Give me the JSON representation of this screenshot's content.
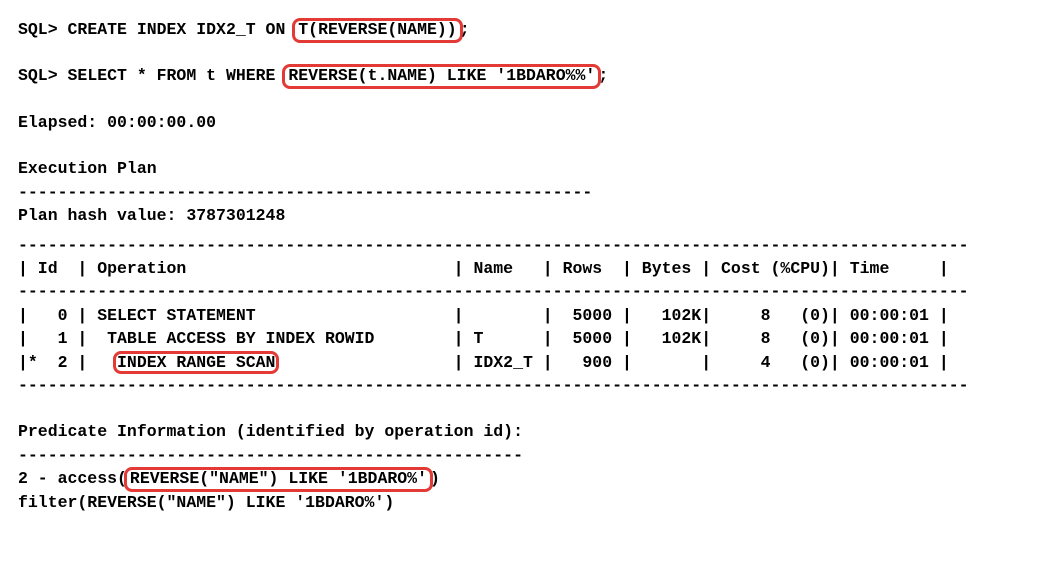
{
  "prompt": "SQL> ",
  "stmt_create": {
    "before_hl": "CREATE INDEX IDX2_T ON ",
    "hl": "T(REVERSE(NAME))",
    "after_hl": ";"
  },
  "stmt_select": {
    "before_hl": "SELECT * FROM t WHERE ",
    "hl": "REVERSE(t.NAME) LIKE '1BDARO%%'",
    "after_hl": ";"
  },
  "elapsed": "Elapsed: 00:00:00.00",
  "ep_title": "Execution Plan",
  "ep_rule": "----------------------------------------------------------",
  "plan_hash": "Plan hash value: 3787301248",
  "table": {
    "rule": "------------------------------------------------------------------------------------------------",
    "head": "| Id  | Operation                           | Name   | Rows  | Bytes | Cost (%CPU)| Time     |",
    "r0": "|   0 | SELECT STATEMENT                    |        |  5000 |   102K|     8   (0)| 00:00:01 |",
    "r1": "|   1 |  TABLE ACCESS BY INDEX ROWID        | T      |  5000 |   102K|     8   (0)| 00:00:01 |",
    "r2": "|*  2 |   INDEX RANGE SCAN                  | IDX2_T |   900 |       |     4   (0)| 00:00:01 |"
  },
  "pred_title": "Predicate Information (identified by operation id):",
  "pred_rule": "---------------------------------------------------",
  "pred": {
    "access_before": "   2 - access(",
    "access_hl": "REVERSE(\"NAME\") LIKE '1BDARO%'",
    "access_after": ")",
    "filter": "       filter(REVERSE(\"NAME\") LIKE '1BDARO%')"
  },
  "chart_data": {
    "type": "table",
    "title": "Execution Plan",
    "plan_hash_value": 3787301248,
    "columns": [
      "Id",
      "Operation",
      "Name",
      "Rows",
      "Bytes",
      "Cost",
      "%CPU",
      "Time"
    ],
    "rows": [
      {
        "Id": 0,
        "Operation": "SELECT STATEMENT",
        "Name": "",
        "Rows": 5000,
        "Bytes": "102K",
        "Cost": 8,
        "%CPU": 0,
        "Time": "00:00:01"
      },
      {
        "Id": 1,
        "Operation": "TABLE ACCESS BY INDEX ROWID",
        "Name": "T",
        "Rows": 5000,
        "Bytes": "102K",
        "Cost": 8,
        "%CPU": 0,
        "Time": "00:00:01"
      },
      {
        "Id": "*2",
        "Operation": "INDEX RANGE SCAN",
        "Name": "IDX2_T",
        "Rows": 900,
        "Bytes": "",
        "Cost": 4,
        "%CPU": 0,
        "Time": "00:00:01"
      }
    ],
    "predicates": [
      {
        "id": 2,
        "kind": "access",
        "expr": "REVERSE(\"NAME\") LIKE '1BDARO%'"
      },
      {
        "id": 2,
        "kind": "filter",
        "expr": "REVERSE(\"NAME\") LIKE '1BDARO%'"
      }
    ]
  }
}
